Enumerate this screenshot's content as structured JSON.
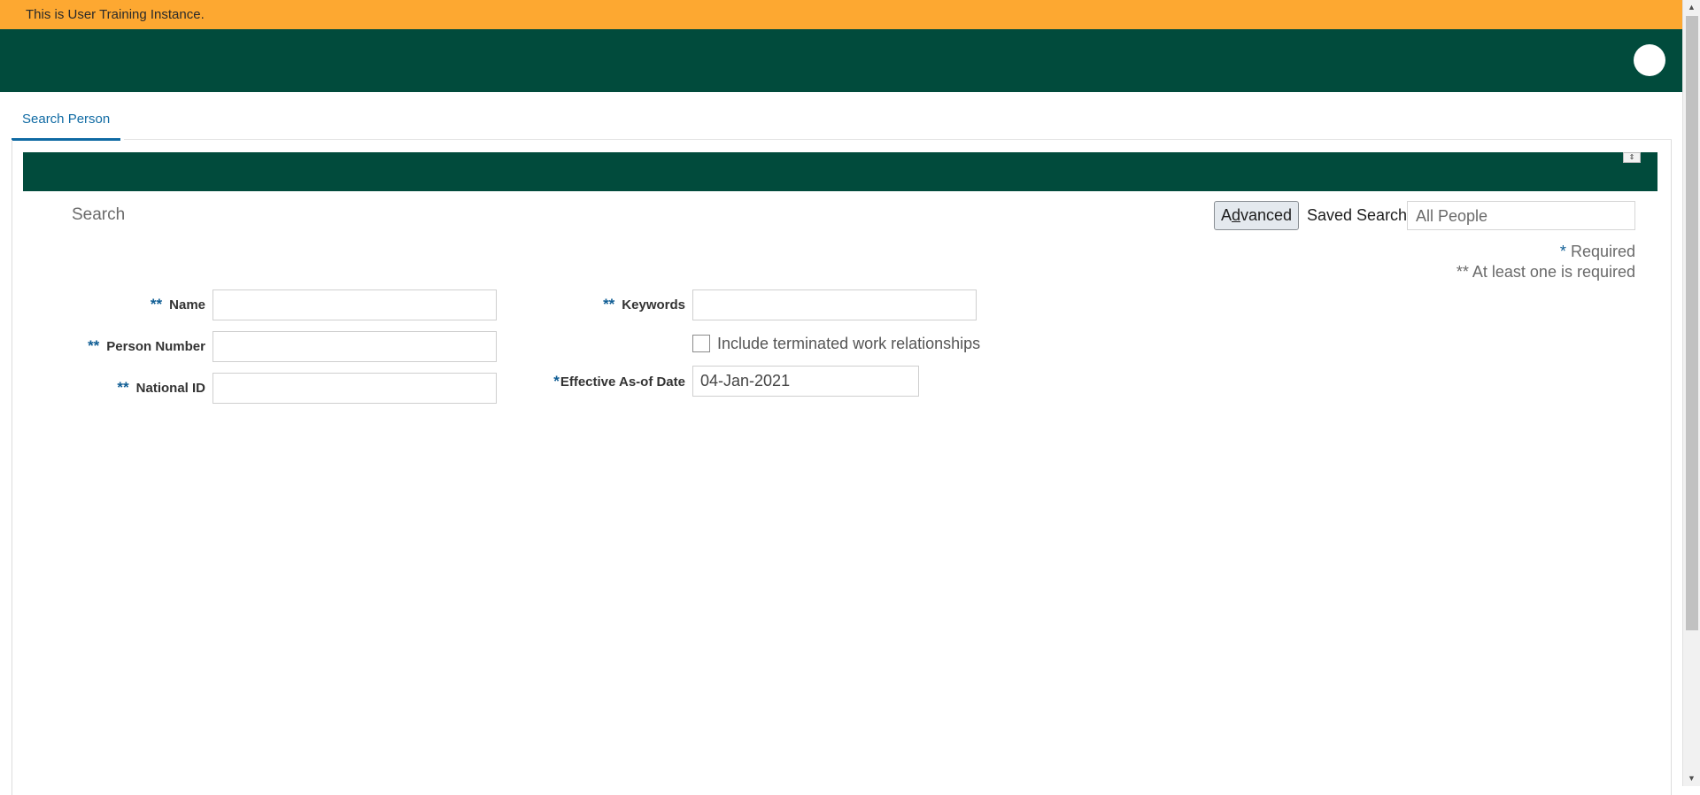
{
  "banner": {
    "text": "This is User Training Instance."
  },
  "tabs": [
    {
      "label": "Search Person"
    }
  ],
  "search": {
    "title": "Search",
    "advanced_label": "Advanced",
    "advanced_mnemonic_letter": "d",
    "saved_search_label": "Saved Search",
    "saved_search_value": "All People"
  },
  "notes": {
    "required_mark": "*",
    "required_text": "Required",
    "at_least_one_text": "** At least one is required"
  },
  "fields": {
    "name": {
      "mark": "**",
      "label": "Name",
      "value": ""
    },
    "person_number": {
      "mark": "**",
      "label": "Person Number",
      "value": ""
    },
    "national_id": {
      "mark": "**",
      "label": "National ID",
      "value": ""
    },
    "keywords": {
      "mark": "**",
      "label": "Keywords",
      "value": ""
    },
    "include_terminated": {
      "label": "Include terminated work relationships",
      "checked": false
    },
    "effective_date": {
      "mark": "*",
      "label": "Effective As-of Date",
      "value": "04-Jan-2021"
    }
  },
  "colors": {
    "banner": "#fda831",
    "header": "#014b3c",
    "accent": "#0f6aa3"
  }
}
